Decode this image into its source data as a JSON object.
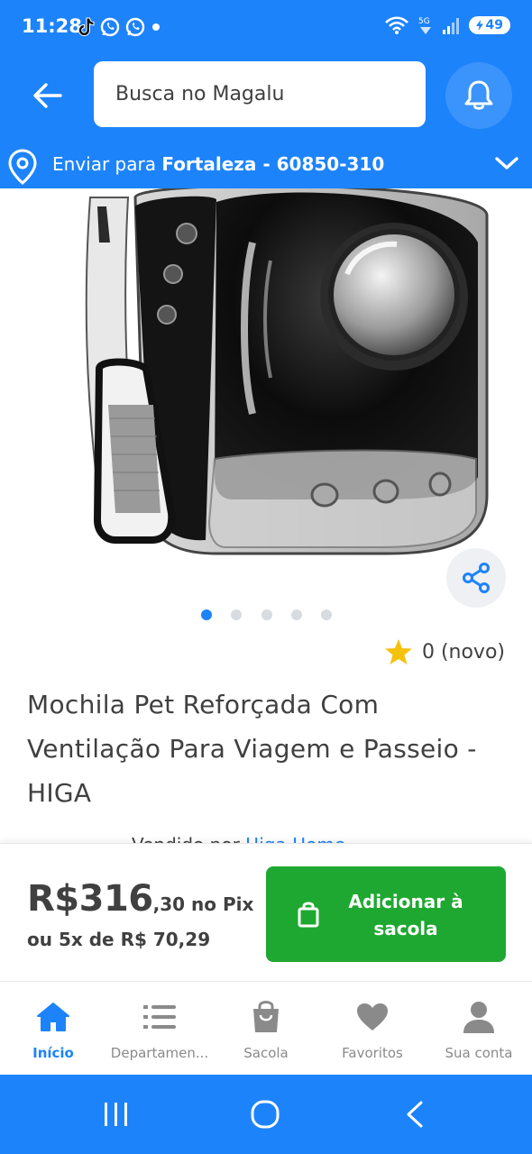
{
  "colors": {
    "brand_blue": "#1d83fb",
    "add_button_green": "#1fa831",
    "star_yellow": "#f4c20d",
    "text_dark": "#404040"
  },
  "status_bar": {
    "time": "11:28",
    "battery": "49",
    "icons": [
      "tiktok-icon",
      "whatsapp-icon",
      "whatsapp-icon",
      "dot-icon",
      "wifi-icon",
      "5g-icon",
      "signal-icon",
      "battery-icon"
    ]
  },
  "header": {
    "search_placeholder": "Busca no Magalu",
    "delivery_prefix": "Enviar para",
    "delivery_location": "Fortaleza - 60850-310"
  },
  "product": {
    "image_count": 5,
    "active_image_index": 0,
    "rating_value": "0 (novo)",
    "title": "Mochila Pet Reforçada Com Ventilação Para Viagem e Passeio - HIGA",
    "seller_prefix": "Vendido por",
    "seller_name": "Higa Home"
  },
  "purchase": {
    "price_main": "R$316",
    "price_cents": ",30 no Pix",
    "installments": "ou 5x de R$ 70,29",
    "add_button_label": "Adicionar à sacola"
  },
  "bottom_nav": {
    "items": [
      {
        "label": "Início",
        "icon": "home-icon",
        "active": true
      },
      {
        "label": "Departamen...",
        "icon": "list-icon",
        "active": false
      },
      {
        "label": "Sacola",
        "icon": "bag-icon",
        "active": false
      },
      {
        "label": "Favoritos",
        "icon": "heart-icon",
        "active": false
      },
      {
        "label": "Sua conta",
        "icon": "user-icon",
        "active": false
      }
    ]
  },
  "system_nav": {
    "buttons": [
      "recents-icon",
      "home-circle-icon",
      "back-chevron-icon"
    ]
  }
}
